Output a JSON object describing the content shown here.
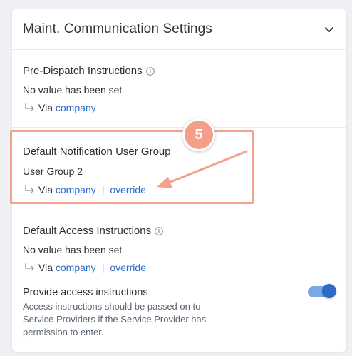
{
  "card": {
    "title": "Maint. Communication Settings"
  },
  "pre_dispatch": {
    "label": "Pre-Dispatch Instructions",
    "value": "No value has been set",
    "via_prefix": "Via",
    "via_link": "company"
  },
  "default_notification": {
    "label": "Default Notification User Group",
    "value": "User Group 2",
    "via_prefix": "Via",
    "via_link": "company",
    "separator": "|",
    "override_link": "override"
  },
  "default_access": {
    "label": "Default Access Instructions",
    "value": "No value has been set",
    "via_prefix": "Via",
    "via_link": "company",
    "separator": "|",
    "override_link": "override"
  },
  "provide_access": {
    "label": "Provide access instructions",
    "description": "Access instructions should be passed on to Service Providers if the Service Provider has permission to enter.",
    "toggle_on": true
  },
  "annotation": {
    "step_number": "5"
  },
  "colors": {
    "link": "#2c6bc7",
    "toggle_track": "#7aa7e8",
    "toggle_knob": "#2c6bc7",
    "highlight": "#f2a18c",
    "badge": "#f4a088"
  }
}
